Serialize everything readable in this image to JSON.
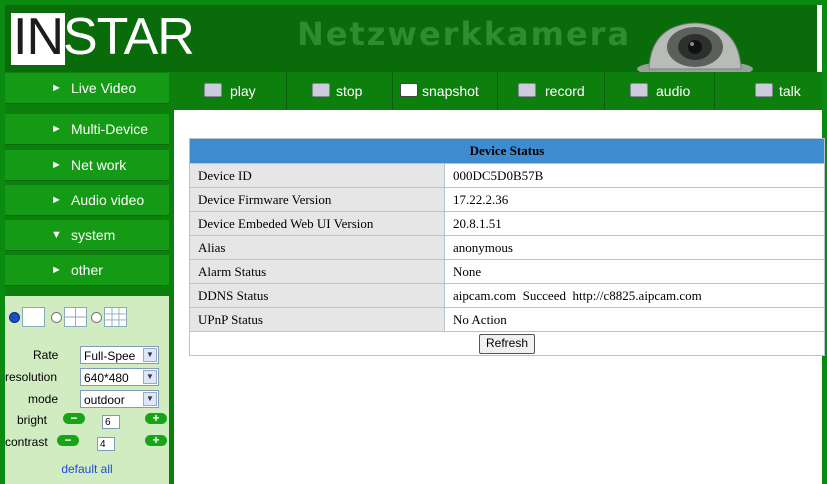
{
  "header": {
    "logo_prefix": "IN",
    "logo_suffix": "STAR",
    "title": "Netzwerkkamera"
  },
  "sidebar": {
    "items": [
      {
        "label": "Live Video",
        "arrow": "►"
      },
      {
        "label": "Multi-Device",
        "arrow": "►"
      },
      {
        "label": "Net work",
        "arrow": "►"
      },
      {
        "label": "Audio video",
        "arrow": "►"
      },
      {
        "label": "system",
        "arrow": "▼"
      },
      {
        "label": "other",
        "arrow": "►"
      }
    ]
  },
  "panel": {
    "layout_selected": 1,
    "rate_label": "Rate",
    "rate_value": "Full-Spee",
    "resolution_label": "resolution",
    "resolution_value": "640*480",
    "mode_label": "mode",
    "mode_value": "outdoor",
    "bright_label": "bright",
    "bright_value": "6",
    "contrast_label": "contrast",
    "contrast_value": "4",
    "minus": "−",
    "plus": "+",
    "default_all": "default all"
  },
  "toolbar": {
    "play": "play",
    "stop": "stop",
    "snapshot": "snapshot",
    "record": "record",
    "audio": "audio",
    "talk": "talk"
  },
  "status": {
    "title": "Device Status",
    "rows": [
      {
        "key": "Device ID",
        "value": "000DC5D0B57B"
      },
      {
        "key": "Device Firmware Version",
        "value": "17.22.2.36"
      },
      {
        "key": "Device Embeded Web UI Version",
        "value": "20.8.1.51"
      },
      {
        "key": "Alias",
        "value": "anonymous"
      },
      {
        "key": "Alarm Status",
        "value": "None"
      },
      {
        "key": "DDNS Status",
        "value": "aipcam.com  Succeed  http://c8825.aipcam.com"
      },
      {
        "key": "UPnP Status",
        "value": "No Action"
      }
    ],
    "refresh": "Refresh"
  },
  "colors": {
    "frame": "#0b8a12",
    "nav": "#149a14",
    "table_header": "#3f8bd0",
    "panel": "#d2ecc1"
  }
}
